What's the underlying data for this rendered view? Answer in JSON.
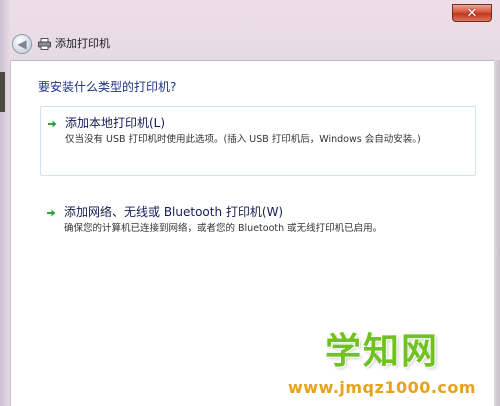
{
  "window": {
    "title": "添加打印机",
    "close_glyph": "✕",
    "back_glyph": "◀"
  },
  "content": {
    "question": "要安装什么类型的打印机?",
    "options": [
      {
        "title": "添加本地打印机(L)",
        "description": "仅当没有 USB 打印机时使用此选项。(插入 USB 打印机后，Windows 会自动安装。)"
      },
      {
        "title": "添加网络、无线或 Bluetooth 打印机(W)",
        "description": "确保您的计算机已连接到网络，或者您的 Bluetooth 或无线打印机已启用。"
      }
    ]
  },
  "watermark": {
    "logo_text": "学知网",
    "url": "www.jmqz1000.com"
  },
  "colors": {
    "question_text": "#1e3287",
    "option_arrow": "#2ea43a",
    "watermark_green": "#6fc21f",
    "watermark_orange": "#e8a21a"
  }
}
